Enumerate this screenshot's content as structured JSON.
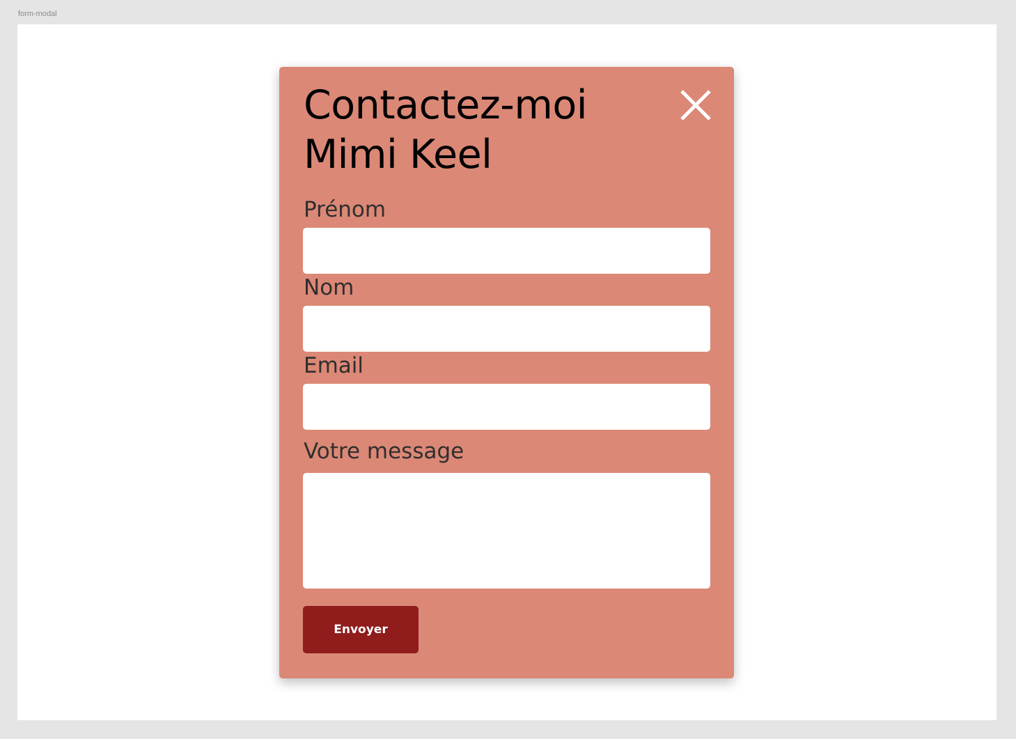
{
  "frame": {
    "label": "form-modal"
  },
  "colors": {
    "page_background": "#e5e5e5",
    "canvas_background": "#ffffff",
    "modal_background": "#db8876",
    "close_icon": "#ffffff",
    "button_background": "#901c1c",
    "button_text": "#ffffff",
    "label_text": "#312e2e"
  },
  "modal": {
    "title_line1": "Contactez-moi",
    "title_line2": "Mimi Keel",
    "close_icon": "close-icon",
    "fields": {
      "first_name": {
        "label": "Prénom",
        "value": ""
      },
      "last_name": {
        "label": "Nom",
        "value": ""
      },
      "email": {
        "label": "Email",
        "value": ""
      },
      "message": {
        "label": "Votre message",
        "value": ""
      }
    },
    "submit_label": "Envoyer"
  }
}
